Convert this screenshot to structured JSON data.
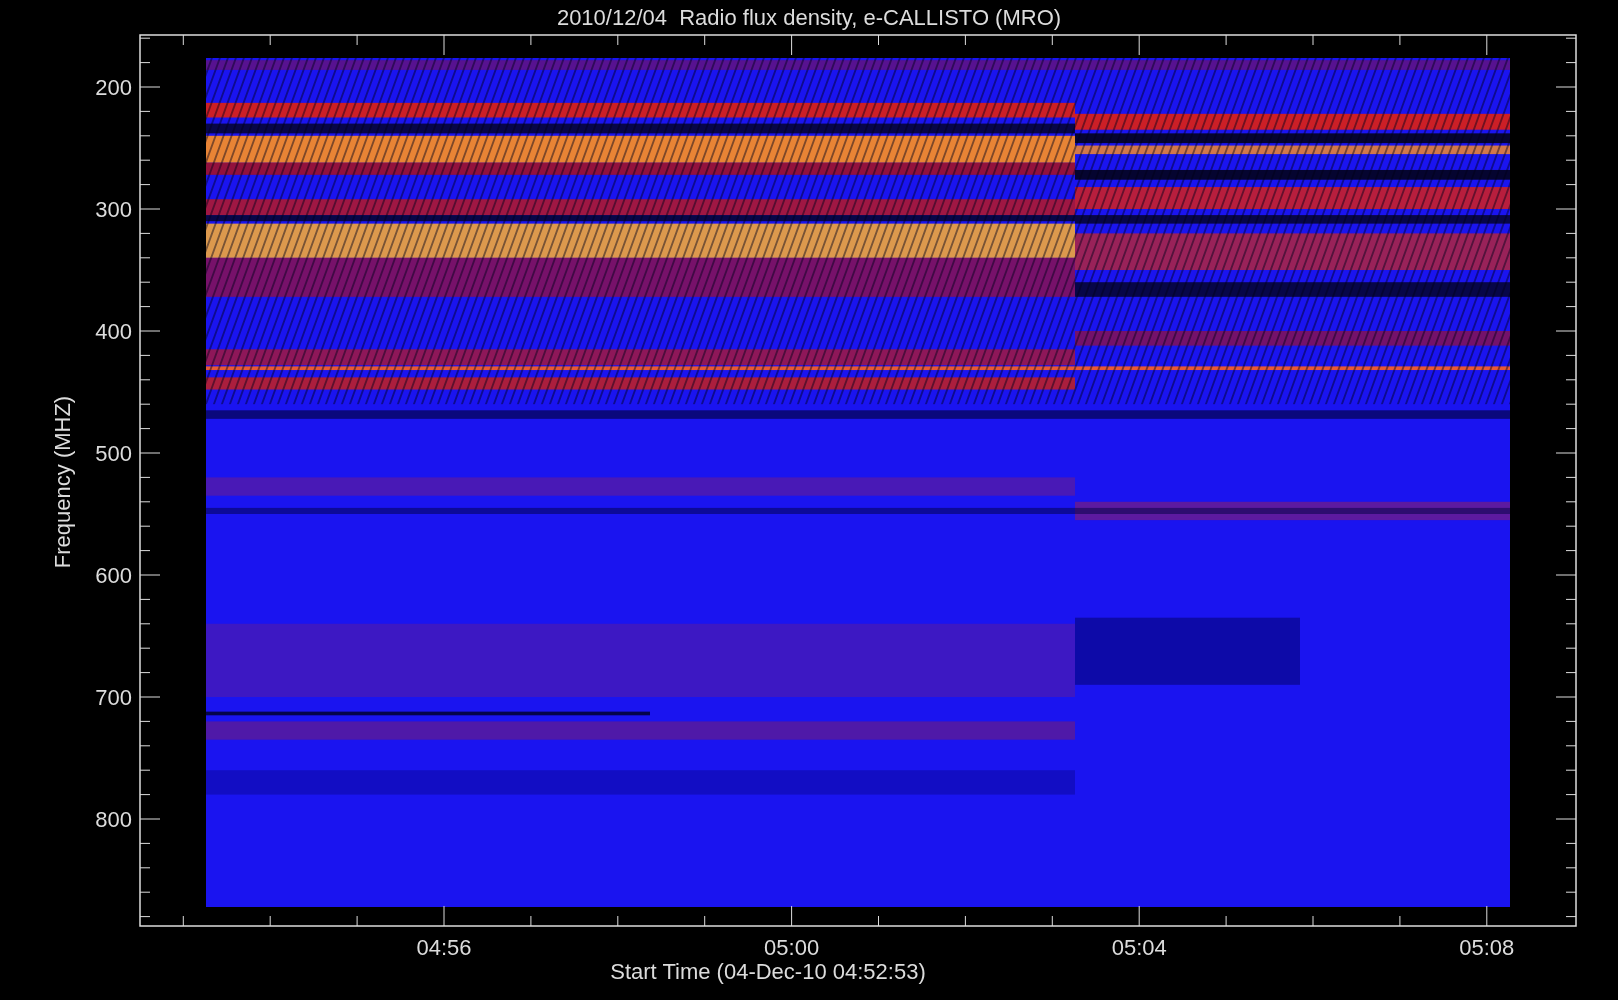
{
  "title": "2010/12/04  Radio flux density, e-CALLISTO (MRO)",
  "y_axis": {
    "label": "Frequency (MHZ)",
    "ticks": [
      "200",
      "300",
      "400",
      "500",
      "600",
      "700",
      "800"
    ]
  },
  "x_axis": {
    "label": "Start Time (04-Dec-10 04:52:53)",
    "ticks": [
      "04:56",
      "05:00",
      "05:04",
      "05:08"
    ]
  }
}
